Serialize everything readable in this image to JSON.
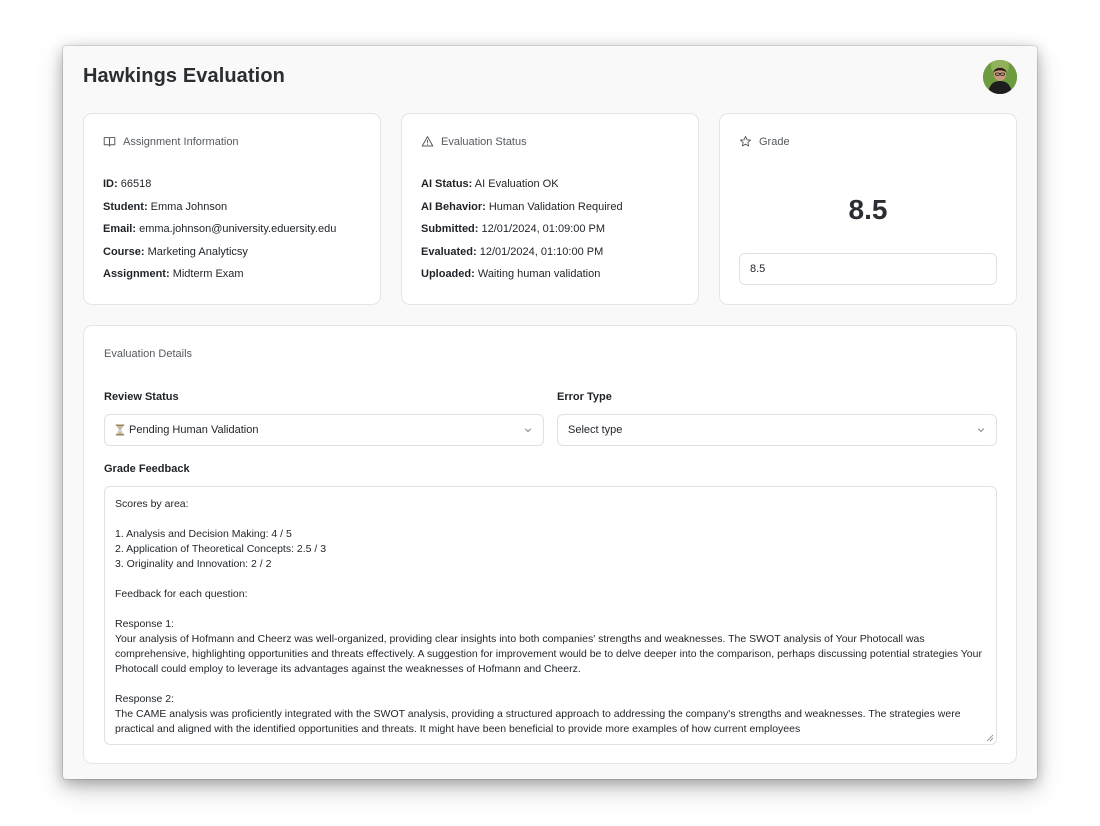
{
  "header": {
    "title": "Hawkings Evaluation"
  },
  "assignment": {
    "heading": "Assignment Information",
    "icon": "book-open-icon",
    "rows": [
      {
        "label": "ID:",
        "value": "66518"
      },
      {
        "label": "Student:",
        "value": "Emma Johnson"
      },
      {
        "label": "Email:",
        "value": "emma.johnson@university.eduersity.edu"
      },
      {
        "label": "Course:",
        "value": "Marketing Analyticsy"
      },
      {
        "label": "Assignment:",
        "value": "Midterm Exam"
      }
    ]
  },
  "status": {
    "heading": "Evaluation Status",
    "icon": "warning-triangle-icon",
    "rows": [
      {
        "label": "AI Status:",
        "value": "AI Evaluation OK"
      },
      {
        "label": "AI Behavior:",
        "value": "Human Validation Required"
      },
      {
        "label": "Submitted:",
        "value": "12/01/2024, 01:09:00 PM"
      },
      {
        "label": "Evaluated:",
        "value": "12/01/2024, 01:10:00 PM"
      },
      {
        "label": "Uploaded:",
        "value": "Waiting human validation"
      }
    ]
  },
  "grade": {
    "heading": "Grade",
    "icon": "star-icon",
    "display_value": "8.5",
    "input_value": "8.5"
  },
  "details": {
    "heading": "Evaluation Details",
    "review_status": {
      "label": "Review Status",
      "icon": "hourglass-icon",
      "selected": "Pending Human Validation"
    },
    "error_type": {
      "label": "Error Type",
      "placeholder": "Select type"
    },
    "feedback": {
      "label": "Grade Feedback",
      "text": "Scores by area:\n\n1. Analysis and Decision Making: 4 / 5\n2. Application of Theoretical Concepts: 2.5 / 3\n3. Originality and Innovation: 2 / 2\n\nFeedback for each question:\n\nResponse 1:\nYour analysis of Hofmann and Cheerz was well-organized, providing clear insights into both companies' strengths and weaknesses. The SWOT analysis of Your Photocall was comprehensive, highlighting opportunities and threats effectively. A suggestion for improvement would be to delve deeper into the comparison, perhaps discussing potential strategies Your Photocall could employ to leverage its advantages against the weaknesses of Hofmann and Cheerz.\n\nResponse 2:\nThe CAME analysis was proficiently integrated with the SWOT analysis, providing a structured approach to addressing the company's strengths and weaknesses. The strategies were practical and aligned with the identified opportunities and threats. It might have been beneficial to provide more examples of how current employees"
    }
  },
  "colors": {
    "window_bg": "#f9f9f9",
    "card_bg": "#ffffff",
    "border": "#e3e5e8",
    "text": "#1f2328",
    "muted": "#55595f"
  }
}
